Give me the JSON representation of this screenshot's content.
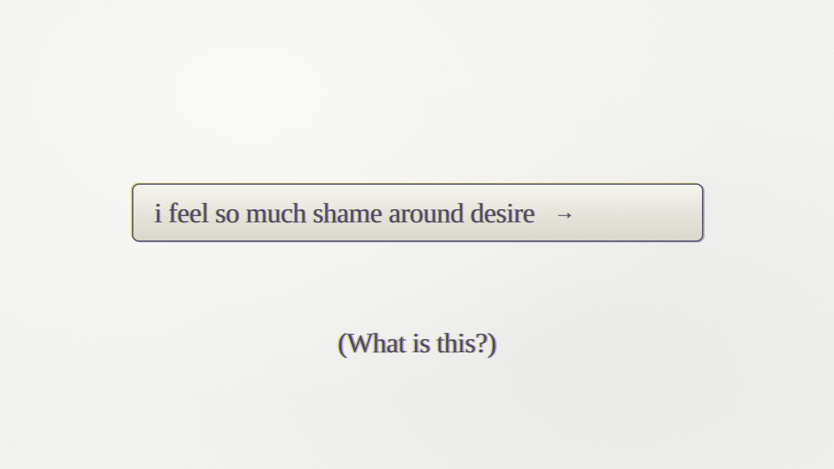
{
  "prompt_button": {
    "label": "i feel so much shame around desire",
    "arrow": "→",
    "arrow_icon": "right-arrow-icon"
  },
  "info_link": {
    "label": "(What is this?)"
  },
  "colors": {
    "background": "#f3f3f1",
    "text": "#4b4c68",
    "button_fill": "#e6e4da",
    "button_border": "#5b5c6e",
    "aberration_yellow": "#d6c428",
    "aberration_blue": "#4636aa"
  }
}
